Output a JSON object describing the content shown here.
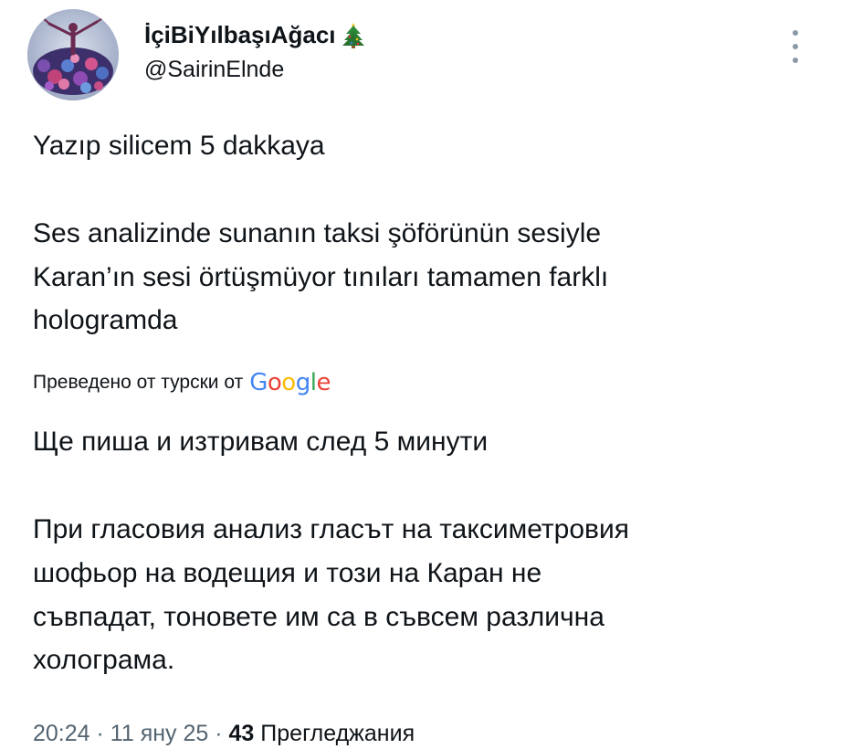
{
  "author": {
    "display_name": "İçiBiYılbaşıAğacı",
    "emoji_icon": "christmas-tree-icon",
    "handle": "@SairinElnde",
    "avatar_icon": "ballerina-flowers-avatar"
  },
  "more_icon": "more-vertical-icon",
  "original_text": {
    "line1": "Yazıp silicem 5 dakkaya",
    "line2": "Ses analizinde sunanın taksi şöförünün sesiyle",
    "line3": "Karan’ın sesi örtüşmüyor tınıları tamamen farklı",
    "line4": "hologramda"
  },
  "translation": {
    "label": "Преведено от турски от",
    "provider": "Google",
    "line1": "Ще пиша и изтривам след 5 минути",
    "line2": "При гласовия анализ гласът на таксиметровия",
    "line3": "шофьор на водещия и този на Каран не",
    "line4": "съвпадат, тоновете им са в съвсем различна",
    "line5": "холограма."
  },
  "meta": {
    "time": "20:24",
    "separator": "·",
    "date": "11 яну 25",
    "views_count": "43",
    "views_label": "Прегледжания"
  },
  "colors": {
    "google_blue": "#4285F4",
    "google_red": "#EA4335",
    "google_yellow": "#FBBC05",
    "google_green": "#34A853",
    "muted_text": "#536471"
  }
}
